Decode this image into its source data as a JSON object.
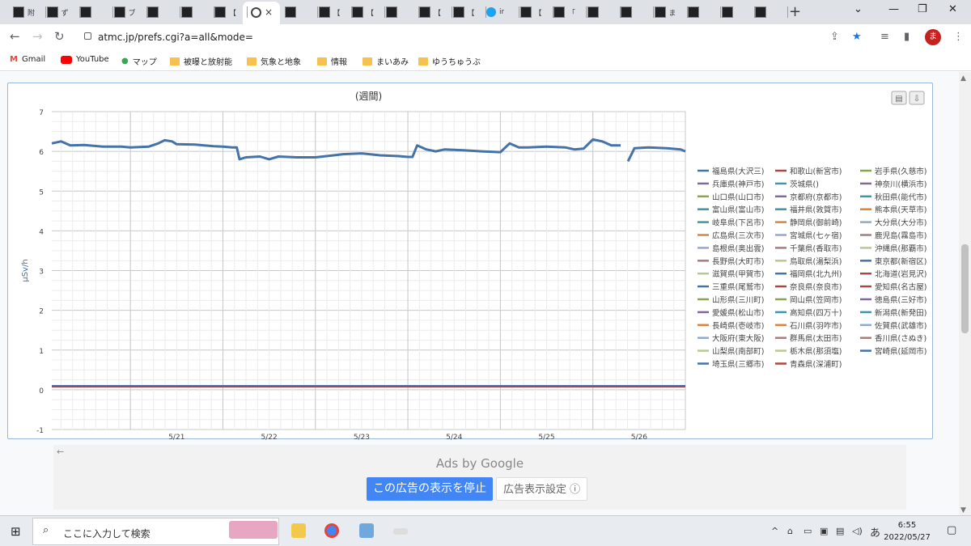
{
  "browser": {
    "tabs": [
      {
        "label": "附"
      },
      {
        "label": "ず"
      },
      {
        "label": ""
      },
      {
        "label": "ブ"
      },
      {
        "label": ""
      },
      {
        "label": ""
      },
      {
        "label": "【"
      },
      {
        "label": ""
      },
      {
        "label": ""
      },
      {
        "label": "【"
      },
      {
        "label": "【"
      },
      {
        "label": ""
      },
      {
        "label": "【"
      },
      {
        "label": "【"
      },
      {
        "label": "ir"
      },
      {
        "label": "【"
      },
      {
        "label": "「"
      },
      {
        "label": ""
      },
      {
        "label": ""
      },
      {
        "label": "ま"
      },
      {
        "label": ""
      },
      {
        "label": ""
      },
      {
        "label": ""
      }
    ],
    "active_tab_close": "×",
    "new_tab": "+",
    "url": "atmc.jp/prefs.cgi?a=all&mode=",
    "avatar_initial": "ま"
  },
  "bookmarks": [
    {
      "label": "Gmail",
      "icon": "gmail-icon"
    },
    {
      "label": "YouTube",
      "icon": "youtube-icon"
    },
    {
      "label": "マップ",
      "icon": "maps-icon"
    },
    {
      "label": "被曝と放射能",
      "icon": "folder-icon"
    },
    {
      "label": "気象と地象",
      "icon": "folder-icon"
    },
    {
      "label": "情報",
      "icon": "folder-icon"
    },
    {
      "label": "まいあみ",
      "icon": "folder-icon"
    },
    {
      "label": "ゆうちゅうぶ",
      "icon": "folder-icon"
    }
  ],
  "chart_data": {
    "type": "line",
    "title": "(週間)",
    "ylabel": "μSv/h",
    "xlabel": "",
    "ylim": [
      -1,
      7
    ],
    "yticks": [
      "-1",
      "0",
      "1",
      "2",
      "3",
      "4",
      "5",
      "6",
      "7"
    ],
    "xticks": [
      "5/21",
      "5/22",
      "5/23",
      "5/24",
      "5/25",
      "5/26"
    ],
    "x_range_days": [
      20.15,
      27.0
    ],
    "grid": true,
    "legend_position": "right",
    "main_series": {
      "name": "福島県(大沢三)",
      "color": "#4572a7",
      "points": [
        [
          20.15,
          6.2
        ],
        [
          20.25,
          6.25
        ],
        [
          20.35,
          6.15
        ],
        [
          20.5,
          6.16
        ],
        [
          20.7,
          6.12
        ],
        [
          20.9,
          6.12
        ],
        [
          21.0,
          6.1
        ],
        [
          21.2,
          6.12
        ],
        [
          21.3,
          6.2
        ],
        [
          21.37,
          6.28
        ],
        [
          21.45,
          6.25
        ],
        [
          21.5,
          6.18
        ],
        [
          21.7,
          6.17
        ],
        [
          21.9,
          6.13
        ],
        [
          22.0,
          6.12
        ],
        [
          22.1,
          6.1
        ],
        [
          22.15,
          6.1
        ],
        [
          22.18,
          5.8
        ],
        [
          22.25,
          5.85
        ],
        [
          22.4,
          5.87
        ],
        [
          22.5,
          5.8
        ],
        [
          22.6,
          5.87
        ],
        [
          22.8,
          5.85
        ],
        [
          23.0,
          5.85
        ],
        [
          23.2,
          5.9
        ],
        [
          23.3,
          5.93
        ],
        [
          23.5,
          5.95
        ],
        [
          23.7,
          5.9
        ],
        [
          23.9,
          5.88
        ],
        [
          24.0,
          5.86
        ],
        [
          24.05,
          5.86
        ],
        [
          24.1,
          6.15
        ],
        [
          24.2,
          6.05
        ],
        [
          24.3,
          6.0
        ],
        [
          24.4,
          6.05
        ],
        [
          24.6,
          6.03
        ],
        [
          24.8,
          6.0
        ],
        [
          25.0,
          5.98
        ],
        [
          25.1,
          6.2
        ],
        [
          25.2,
          6.1
        ],
        [
          25.3,
          6.1
        ],
        [
          25.5,
          6.12
        ],
        [
          25.7,
          6.1
        ],
        [
          25.8,
          6.05
        ],
        [
          25.9,
          6.07
        ],
        [
          26.0,
          6.3
        ],
        [
          26.1,
          6.25
        ],
        [
          26.2,
          6.15
        ],
        [
          26.3,
          6.15
        ],
        [
          null,
          null
        ],
        [
          26.38,
          5.75
        ],
        [
          26.45,
          6.08
        ],
        [
          26.6,
          6.1
        ],
        [
          26.8,
          6.08
        ],
        [
          26.95,
          6.05
        ],
        [
          27.0,
          6.0
        ]
      ]
    },
    "other_series_level": 0.08,
    "legend": [
      {
        "name": "福島県(大沢三)",
        "color": "#4572a7"
      },
      {
        "name": "和歌山(新宮市)",
        "color": "#aa4643"
      },
      {
        "name": "岩手県(久慈市)",
        "color": "#89a54e"
      },
      {
        "name": "兵庫県(神戸市)",
        "color": "#80699b"
      },
      {
        "name": "茨城県()",
        "color": "#3d96ae"
      },
      {
        "name": "神奈川(横浜市)",
        "color": "#80699b"
      },
      {
        "name": "山口県(山口市)",
        "color": "#89a54e"
      },
      {
        "name": "京都府(京都市)",
        "color": "#80699b"
      },
      {
        "name": "秋田県(能代市)",
        "color": "#3d96ae"
      },
      {
        "name": "富山県(富山市)",
        "color": "#3d96ae"
      },
      {
        "name": "福井県(敦賀市)",
        "color": "#3d96ae"
      },
      {
        "name": "熊本県(天草市)",
        "color": "#db843d"
      },
      {
        "name": "岐阜県(下呂市)",
        "color": "#3d96ae"
      },
      {
        "name": "静岡県(御前崎)",
        "color": "#db843d"
      },
      {
        "name": "大分県(大分市)",
        "color": "#92a8cd"
      },
      {
        "name": "広島県(三次市)",
        "color": "#db843d"
      },
      {
        "name": "宮城県(七ヶ宿)",
        "color": "#92a8cd"
      },
      {
        "name": "鹿児島(霧島市)",
        "color": "#a47d7c"
      },
      {
        "name": "島根県(奥出雲)",
        "color": "#92a8cd"
      },
      {
        "name": "千葉県(香取市)",
        "color": "#a47d7c"
      },
      {
        "name": "沖縄県(那覇市)",
        "color": "#b5ca92"
      },
      {
        "name": "長野県(大町市)",
        "color": "#a47d7c"
      },
      {
        "name": "鳥取県(湯梨浜)",
        "color": "#b5ca92"
      },
      {
        "name": "東京都(新宿区)",
        "color": "#4572a7"
      },
      {
        "name": "滋賀県(甲賀市)",
        "color": "#b5ca92"
      },
      {
        "name": "福岡県(北九州)",
        "color": "#4572a7"
      },
      {
        "name": "北海道(岩見沢)",
        "color": "#aa4643"
      },
      {
        "name": "三重県(尾鷲市)",
        "color": "#4572a7"
      },
      {
        "name": "奈良県(奈良市)",
        "color": "#aa4643"
      },
      {
        "name": "愛知県(名古屋)",
        "color": "#aa4643"
      },
      {
        "name": "山形県(三川町)",
        "color": "#89a54e"
      },
      {
        "name": "岡山県(笠岡市)",
        "color": "#89a54e"
      },
      {
        "name": "徳島県(三好市)",
        "color": "#80699b"
      },
      {
        "name": "愛媛県(松山市)",
        "color": "#80699b"
      },
      {
        "name": "高知県(四万十)",
        "color": "#3d96ae"
      },
      {
        "name": "新潟県(新発田)",
        "color": "#3d96ae"
      },
      {
        "name": "長崎県(壱岐市)",
        "color": "#db843d"
      },
      {
        "name": "石川県(羽咋市)",
        "color": "#db843d"
      },
      {
        "name": "佐賀県(武雄市)",
        "color": "#92a8cd"
      },
      {
        "name": "大阪府(東大阪)",
        "color": "#92a8cd"
      },
      {
        "name": "群馬県(太田市)",
        "color": "#a47d7c"
      },
      {
        "name": "香川県(さぬき)",
        "color": "#a47d7c"
      },
      {
        "name": "山梨県(南部町)",
        "color": "#b5ca92"
      },
      {
        "name": "栃木県(那須塩)",
        "color": "#b5ca92"
      },
      {
        "name": "宮崎県(延岡市)",
        "color": "#4572a7"
      },
      {
        "name": "埼玉県(三郷市)",
        "color": "#4572a7"
      },
      {
        "name": "青森県(深浦町)",
        "color": "#aa4643"
      }
    ]
  },
  "ad": {
    "ads_by_label": "Ads by Google",
    "stop_label": "この広告の表示を停止",
    "settings_label": "広告表示設定 ⓘ",
    "back_arrow": "←"
  },
  "taskbar": {
    "search_placeholder": "ここに入力して検索",
    "time": "6:55",
    "date": "2022/05/27",
    "ime": "あ"
  }
}
